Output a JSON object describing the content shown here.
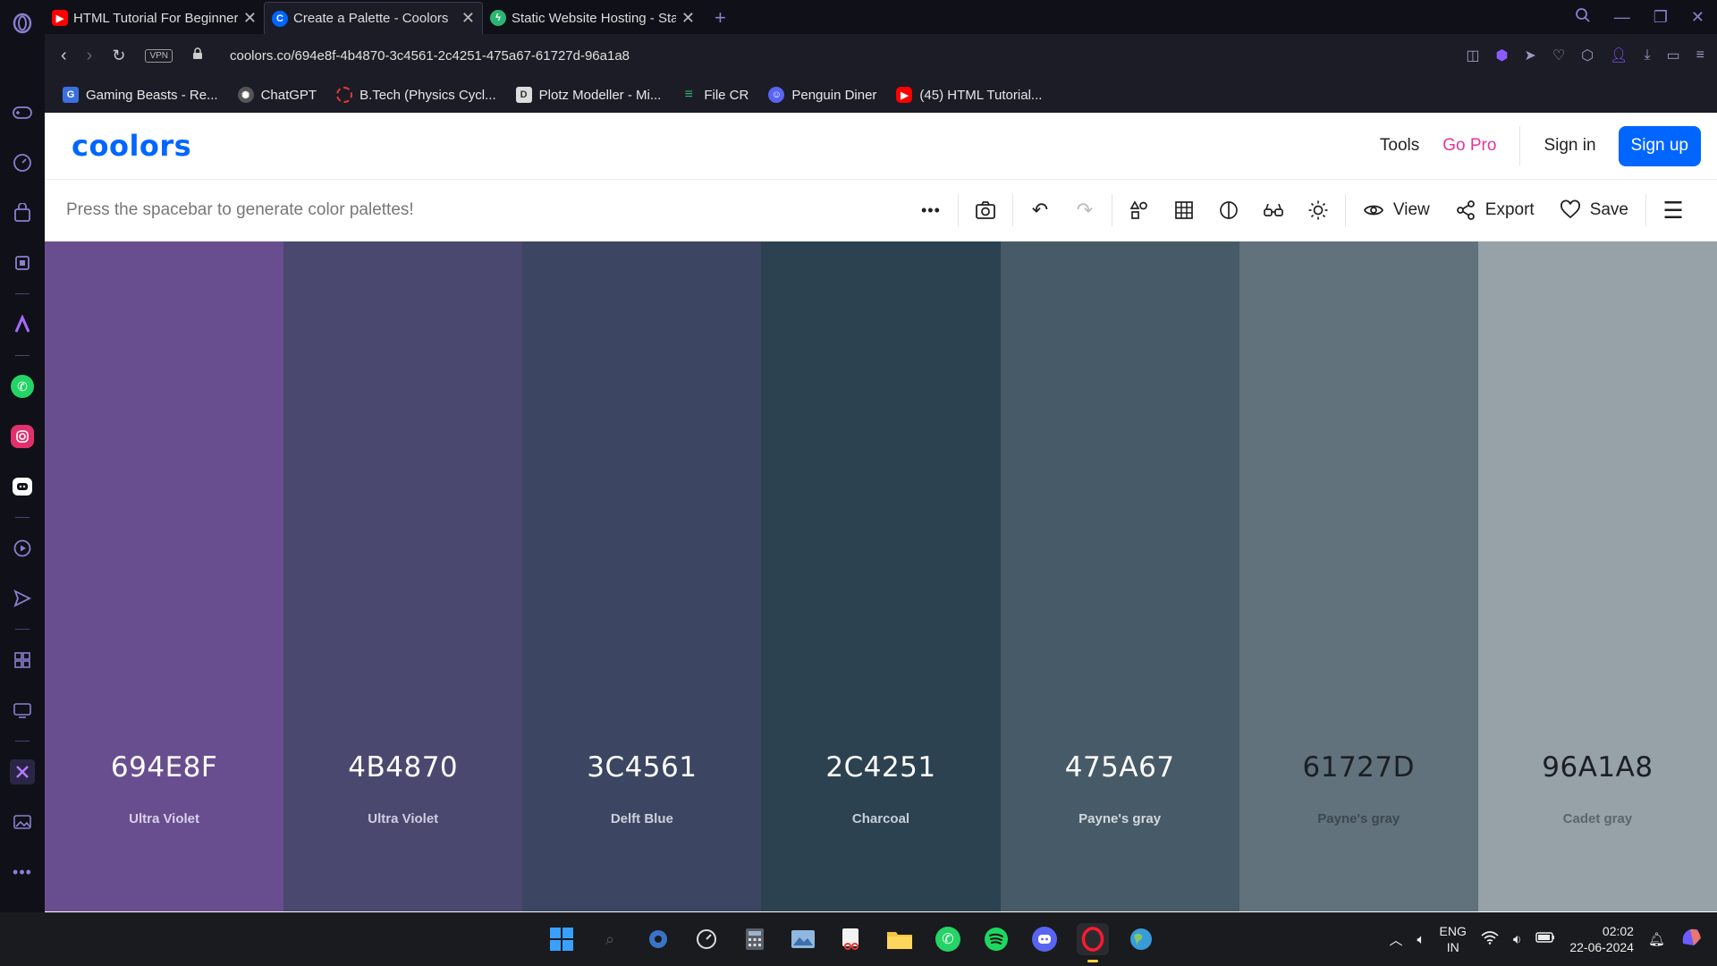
{
  "browser": {
    "tabs": [
      {
        "title": "HTML Tutorial For Beginners",
        "active": false,
        "favicon": "youtube-icon"
      },
      {
        "title": "Create a Palette - Coolors",
        "active": true,
        "favicon": "coolors-icon"
      },
      {
        "title": "Static Website Hosting - Static",
        "active": false,
        "favicon": "bolt-icon"
      }
    ],
    "vpn_label": "VPN",
    "url": "coolors.co/694e8f-4b4870-3c4561-2c4251-475a67-61727d-96a1a8",
    "bookmarks": [
      {
        "label": "Gaming Beasts - Re...",
        "icon": "G",
        "color": "#3b6fe0"
      },
      {
        "label": "ChatGPT",
        "icon": "C",
        "color": "#444"
      },
      {
        "label": "B.Tech (Physics Cycl...",
        "icon": "B",
        "color": "#c0392b"
      },
      {
        "label": "Plotz Modeller - Mi...",
        "icon": "P",
        "color": "#777"
      },
      {
        "label": "File CR",
        "icon": "F",
        "color": "#2bb673"
      },
      {
        "label": "Penguin Diner",
        "icon": "P",
        "color": "#5865f2"
      },
      {
        "label": "(45) HTML Tutorial...",
        "icon": "▶",
        "color": "#ff0000"
      }
    ]
  },
  "site": {
    "logo": "coolors",
    "nav": {
      "tools": "Tools",
      "gopro": "Go Pro",
      "signin": "Sign in",
      "signup": "Sign up"
    },
    "hint": "Press the spacebar to generate color palettes!",
    "actions": {
      "view": "View",
      "export": "Export",
      "save": "Save"
    }
  },
  "palette": [
    {
      "hex": "694E8F",
      "name": "Ultra Violet",
      "color": "#694e8f",
      "text": "#ffffff",
      "sub": "#d9d0e8"
    },
    {
      "hex": "4B4870",
      "name": "Ultra Violet",
      "color": "#4b4870",
      "text": "#ffffff",
      "sub": "#cfcde0"
    },
    {
      "hex": "3C4561",
      "name": "Delft Blue",
      "color": "#3c4561",
      "text": "#ffffff",
      "sub": "#ccd0dc"
    },
    {
      "hex": "2C4251",
      "name": "Charcoal",
      "color": "#2c4251",
      "text": "#ffffff",
      "sub": "#c6cfd6"
    },
    {
      "hex": "475A67",
      "name": "Payne's gray",
      "color": "#475a67",
      "text": "#ffffff",
      "sub": "#d2d8dd"
    },
    {
      "hex": "61727D",
      "name": "Payne's gray",
      "color": "#61727d",
      "text": "#1b1f23",
      "sub": "#3d4850"
    },
    {
      "hex": "96A1A8",
      "name": "Cadet gray",
      "color": "#96a1a8",
      "text": "#1b1f23",
      "sub": "#5c666c"
    }
  ],
  "taskbar": {
    "lang": "ENG",
    "region": "IN",
    "time": "02:02",
    "date": "22-06-2024"
  }
}
